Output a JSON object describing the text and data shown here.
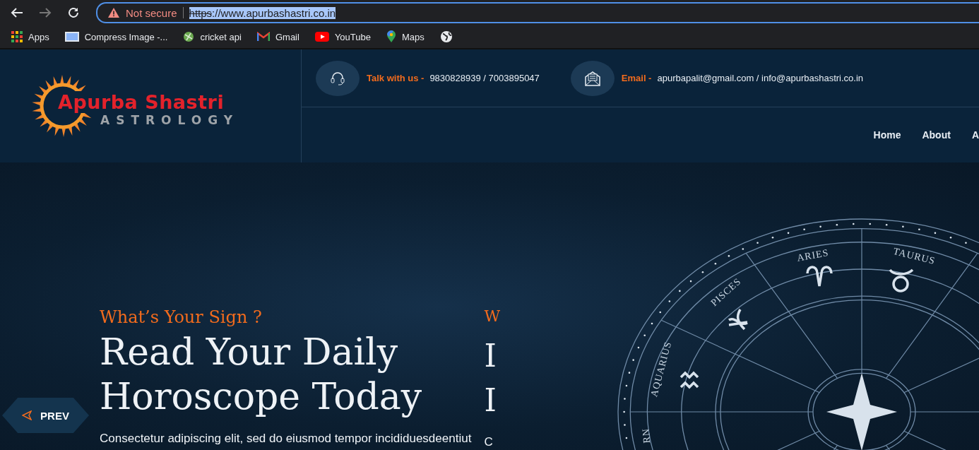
{
  "browser": {
    "nav_buttons": [
      {
        "kind": "back",
        "disabled": false
      },
      {
        "kind": "forward",
        "disabled": true
      },
      {
        "kind": "reload",
        "disabled": false
      }
    ],
    "security_label": "Not secure",
    "url_scheme": "https",
    "url_rest": "://www.apurbashastri.co.in",
    "url_selected": true,
    "bookmarks": [
      {
        "kind": "apps",
        "label": "Apps"
      },
      {
        "kind": "image",
        "label": "Compress Image -..."
      },
      {
        "kind": "ball",
        "label": "cricket api"
      },
      {
        "kind": "gmail",
        "label": "Gmail"
      },
      {
        "kind": "youtube",
        "label": "YouTube"
      },
      {
        "kind": "maps",
        "label": "Maps"
      },
      {
        "kind": "globe"
      }
    ]
  },
  "header": {
    "logo": {
      "name": "Apurba Shastri",
      "tagline": "ASTROLOGY"
    },
    "contacts": [
      {
        "kind": "phone",
        "label": "Talk with us -",
        "value": "9830828939 / 7003895047"
      },
      {
        "kind": "email",
        "label": "Email -",
        "value": "apurbapalit@gmail.com / info@apurbashastri.co.in"
      }
    ],
    "nav": [
      "Home",
      "About",
      "A"
    ]
  },
  "hero": {
    "eyebrow": "What’s Your Sign ?",
    "title_lines": [
      "Read Your Daily",
      "Horoscope Today"
    ],
    "text": "Consectetur adipiscing elit, sed do eiusmod tempor incididuesdeentiut",
    "prev_label": "PREV",
    "next_slide_peek": [
      "W",
      "I",
      "I",
      "C"
    ],
    "wheel_labels": [
      "ARIES",
      "TAURUS",
      "PISCES",
      "AQUARIUS",
      "RN"
    ]
  }
}
